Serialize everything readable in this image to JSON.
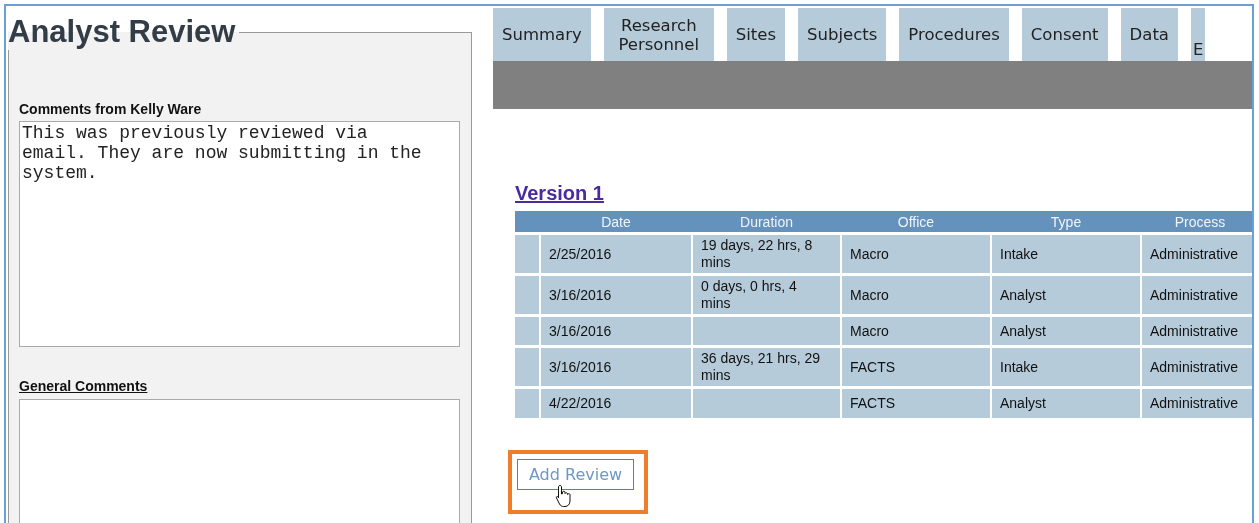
{
  "analyst_review": {
    "title": "Analyst Review",
    "comments_from": {
      "label": "Comments from Kelly Ware",
      "value": "This was previously reviewed via email. They are now submitting in the system."
    },
    "general_comments": {
      "label": "General Comments"
    }
  },
  "tabs": [
    {
      "label": "Summary",
      "selected": false
    },
    {
      "label": "Research Personnel",
      "selected": false
    },
    {
      "label": "Sites",
      "selected": false
    },
    {
      "label": "Subjects",
      "selected": false
    },
    {
      "label": "Procedures",
      "selected": false
    },
    {
      "label": "Consent",
      "selected": false
    },
    {
      "label": "Data",
      "selected": false
    },
    {
      "label": "E",
      "selected": false
    }
  ],
  "version": {
    "title": "Version 1",
    "table": {
      "columns": [
        "Date",
        "Duration",
        "Office",
        "Type",
        "Process"
      ],
      "rows": [
        [
          "2/25/2016",
          "19 days, 22 hrs, 8 mins",
          "Macro",
          "Intake",
          "Administrative"
        ],
        [
          "3/16/2016",
          "0 days, 0 hrs, 4 mins",
          "Macro",
          "Analyst",
          "Administrative"
        ],
        [
          "3/16/2016",
          "",
          "Macro",
          "Analyst",
          "Administrative"
        ],
        [
          "3/16/2016",
          "36 days, 21 hrs, 29 mins",
          "FACTS",
          "Intake",
          "Administrative"
        ],
        [
          "4/22/2016",
          "",
          "FACTS",
          "Analyst",
          "Administrative"
        ]
      ]
    }
  },
  "add_review": {
    "label": "Add Review",
    "highlighted": true
  }
}
